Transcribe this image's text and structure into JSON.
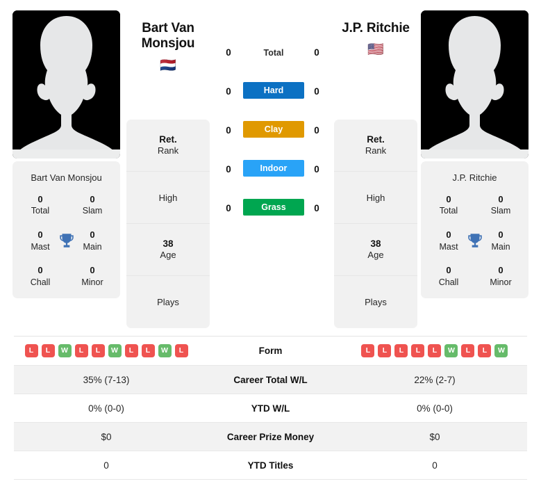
{
  "players": {
    "left": {
      "name": "Bart Van Monsjou",
      "display_name": "Bart Van Monsjou",
      "flag": "🇳🇱",
      "flag_name": "netherlands-flag",
      "titles": {
        "total": {
          "value": "0",
          "label": "Total"
        },
        "slam": {
          "value": "0",
          "label": "Slam"
        },
        "mast": {
          "value": "0",
          "label": "Mast"
        },
        "main": {
          "value": "0",
          "label": "Main"
        },
        "chall": {
          "value": "0",
          "label": "Chall"
        },
        "minor": {
          "value": "0",
          "label": "Minor"
        }
      },
      "info": {
        "rank_value": "Ret.",
        "rank_label": "Rank",
        "high_value": "",
        "high_label": "High",
        "age_value": "38",
        "age_label": "Age",
        "plays_value": "",
        "plays_label": "Plays"
      }
    },
    "right": {
      "name": "J.P. Ritchie",
      "display_name": "J.P. Ritchie",
      "flag": "🇺🇸",
      "flag_name": "usa-flag",
      "titles": {
        "total": {
          "value": "0",
          "label": "Total"
        },
        "slam": {
          "value": "0",
          "label": "Slam"
        },
        "mast": {
          "value": "0",
          "label": "Mast"
        },
        "main": {
          "value": "0",
          "label": "Main"
        },
        "chall": {
          "value": "0",
          "label": "Chall"
        },
        "minor": {
          "value": "0",
          "label": "Minor"
        }
      },
      "info": {
        "rank_value": "Ret.",
        "rank_label": "Rank",
        "high_value": "",
        "high_label": "High",
        "age_value": "38",
        "age_label": "Age",
        "plays_value": "",
        "plays_label": "Plays"
      }
    }
  },
  "head_to_head": {
    "rows": [
      {
        "label": "Total",
        "left": "0",
        "right": "0",
        "badge": false,
        "color": ""
      },
      {
        "label": "Hard",
        "left": "0",
        "right": "0",
        "badge": true,
        "color": "#0c71c3"
      },
      {
        "label": "Clay",
        "left": "0",
        "right": "0",
        "badge": true,
        "color": "#e09900"
      },
      {
        "label": "Indoor",
        "left": "0",
        "right": "0",
        "badge": true,
        "color": "#29a3f7"
      },
      {
        "label": "Grass",
        "left": "0",
        "right": "0",
        "badge": true,
        "color": "#00a650"
      }
    ]
  },
  "stats": {
    "form": {
      "label": "Form",
      "left": [
        "L",
        "L",
        "W",
        "L",
        "L",
        "W",
        "L",
        "L",
        "W",
        "L"
      ],
      "right": [
        "L",
        "L",
        "L",
        "L",
        "L",
        "W",
        "L",
        "L",
        "W"
      ],
      "win_color": "#66bb6a",
      "loss_color": "#ef5350"
    },
    "rows": [
      {
        "label": "Career Total W/L",
        "left": "35% (7-13)",
        "right": "22% (2-7)"
      },
      {
        "label": "YTD W/L",
        "left": "0% (0-0)",
        "right": "0% (0-0)"
      },
      {
        "label": "Career Prize Money",
        "left": "$0",
        "right": "$0"
      },
      {
        "label": "YTD Titles",
        "left": "0",
        "right": "0"
      }
    ]
  },
  "icons": {
    "trophy": "trophy-icon",
    "avatar": "player-photo-placeholder"
  }
}
